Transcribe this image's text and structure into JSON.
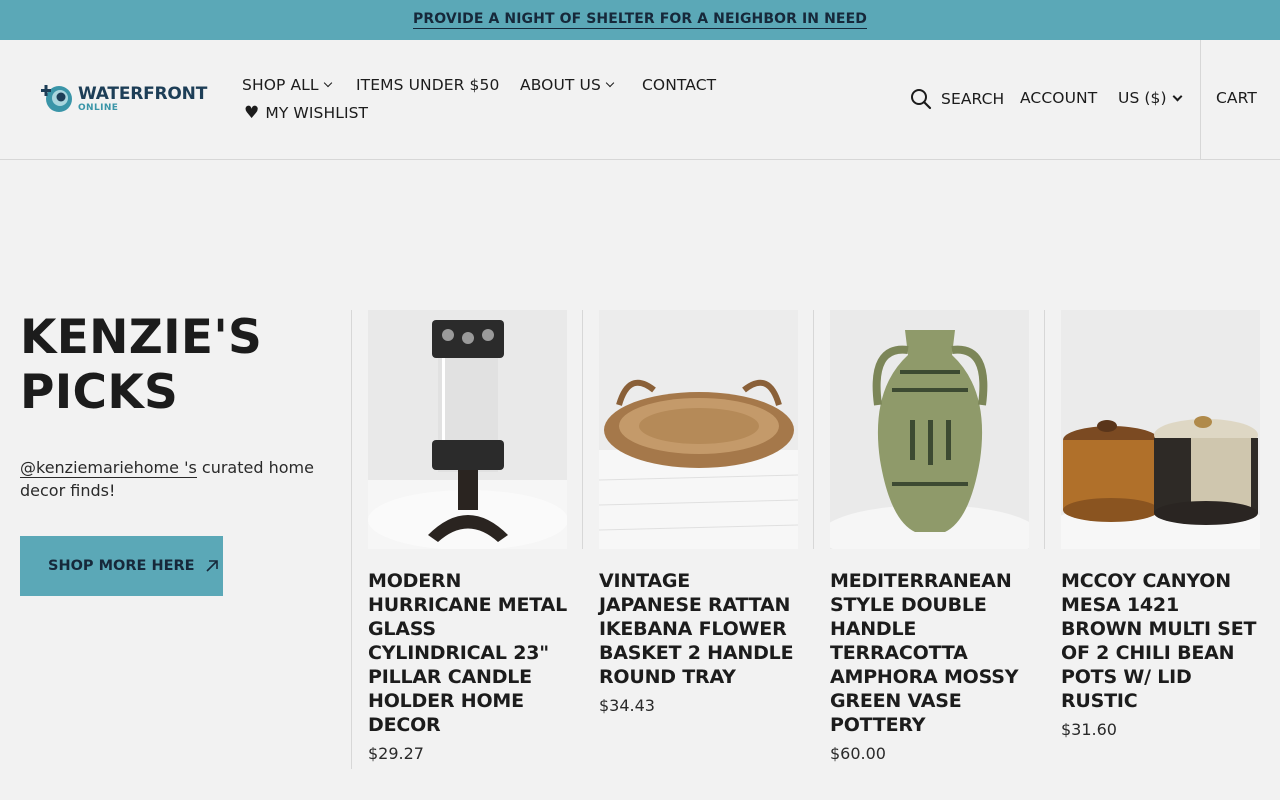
{
  "announcement": {
    "text": "PROVIDE A NIGHT OF SHELTER FOR A NEIGHBOR IN NEED"
  },
  "brand": {
    "name": "WATERFRONT",
    "tagline": "ONLINE",
    "colors": {
      "primary": "#1d3e57",
      "accent": "#5ba8b7"
    }
  },
  "nav": {
    "shop_all": "SHOP ALL",
    "items_under": "ITEMS UNDER $50",
    "about_us": "ABOUT US",
    "contact": "CONTACT",
    "wishlist": "MY WISHLIST"
  },
  "utility": {
    "search": "SEARCH",
    "account": "ACCOUNT",
    "currency": "US ($)",
    "cart": "CART"
  },
  "section": {
    "title": "KENZIE'S PICKS",
    "handle": "@kenziemariehome 's",
    "description_rest": " curated home decor finds!",
    "cta_label": "SHOP MORE HERE"
  },
  "products": [
    {
      "title": "MODERN HURRICANE METAL GLASS CYLINDRICAL 23\" PILLAR CANDLE HOLDER HOME DECOR",
      "price": "$29.27"
    },
    {
      "title": "VINTAGE JAPANESE RATTAN IKEBANA FLOWER BASKET 2 HANDLE ROUND TRAY",
      "price": "$34.43"
    },
    {
      "title": "MEDITERRANEAN STYLE DOUBLE HANDLE TERRACOTTA AMPHORA MOSSY GREEN VASE POTTERY",
      "price": "$60.00"
    },
    {
      "title": "MCCOY CANYON MESA 1421 BROWN MULTI SET OF 2 CHILI BEAN POTS W/ LID RUSTIC",
      "price": "$31.60"
    }
  ]
}
